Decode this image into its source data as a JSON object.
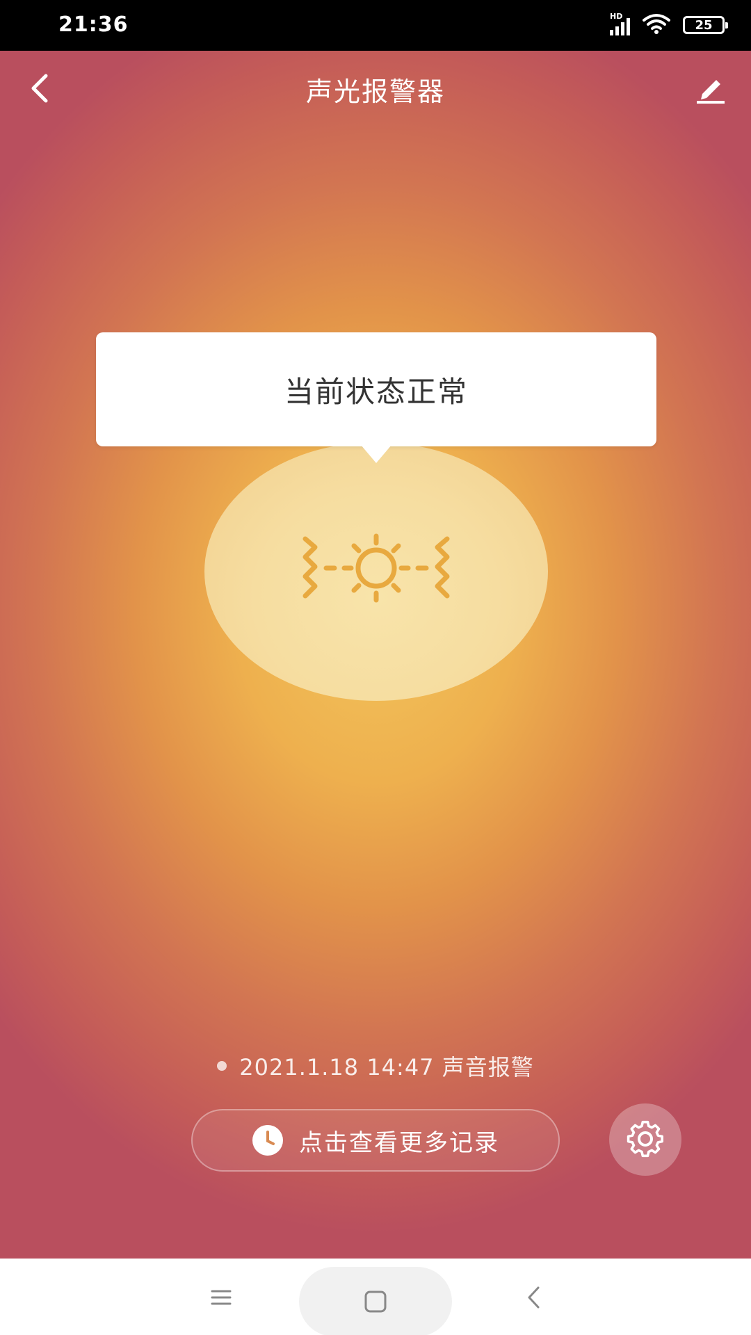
{
  "status_bar": {
    "time": "21:36",
    "network_label": "HD",
    "battery": "25"
  },
  "nav": {
    "title": "声光报警器",
    "back_icon": "chevron-left-icon",
    "edit_icon": "pencil-icon"
  },
  "device": {
    "status_text": "当前状态正常",
    "icon": "sound-light-alarm-icon"
  },
  "last_record": {
    "text": "2021.1.18 14:47 声音报警"
  },
  "history_button": {
    "label": "点击查看更多记录",
    "icon": "clock-icon"
  },
  "settings_button": {
    "icon": "gear-icon"
  },
  "system_nav": {
    "menu_icon": "menu-icon",
    "home_icon": "home-square-icon",
    "back_icon": "back-chevron-icon"
  },
  "colors": {
    "gradient_center": "#f2c45c",
    "gradient_edge": "#b94f5e",
    "icon_color": "#e8a93f",
    "status_bar": "#000000"
  }
}
